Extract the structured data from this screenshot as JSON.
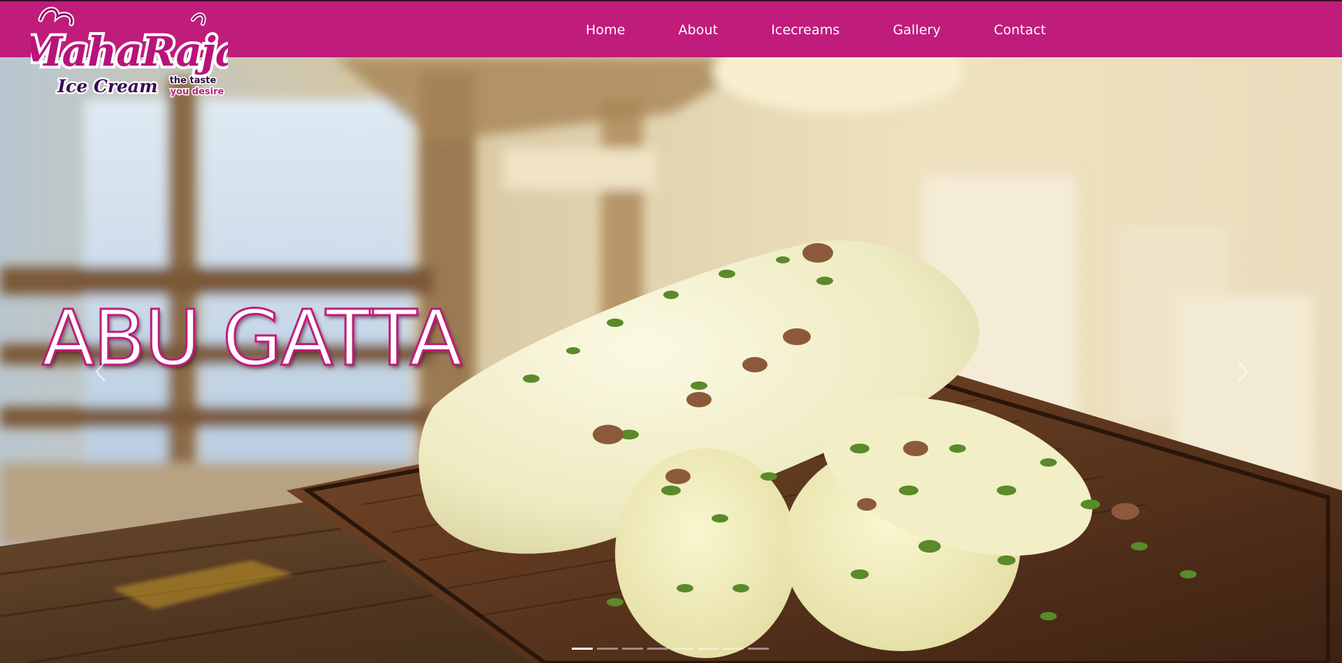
{
  "brand": {
    "name": "MahaRaja",
    "sub": "Ice Cream",
    "tagline_1": "the taste",
    "tagline_2": "you desire",
    "primary_color": "#c01c7c"
  },
  "nav": {
    "items": [
      {
        "label": "Home"
      },
      {
        "label": "About"
      },
      {
        "label": "Icecreams"
      },
      {
        "label": "Gallery"
      },
      {
        "label": "Contact"
      }
    ]
  },
  "hero": {
    "slide_title": "ABU GATTA",
    "prev_icon": "chevron-left-icon",
    "next_icon": "chevron-right-icon",
    "slide_count": 8,
    "active_slide": 1
  }
}
